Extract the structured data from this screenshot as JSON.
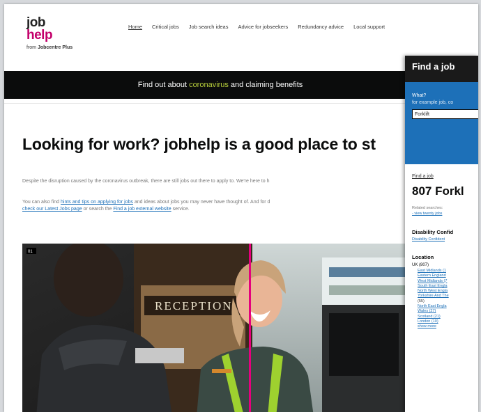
{
  "logo": {
    "line1": "job",
    "line2": "help",
    "from_prefix": "from ",
    "from_name": "Jobcentre Plus"
  },
  "nav": [
    {
      "label": "Home",
      "active": true
    },
    {
      "label": "Critical jobs"
    },
    {
      "label": "Job search ideas"
    },
    {
      "label": "Advice for jobseekers"
    },
    {
      "label": "Redundancy advice"
    },
    {
      "label": "Local support"
    }
  ],
  "banner": {
    "before": "Find out about",
    "highlight": "coronavirus",
    "after": "and claiming benefits"
  },
  "main": {
    "heading": "Looking for work? jobhelp is a good place to st",
    "para1": "Despite the disruption caused by the coronavirus outbreak, there are still jobs out there to apply to. We're here to h",
    "para2": {
      "t1": "You can also find ",
      "l1": "hints and tips on applying for jobs",
      "t2": " and ideas about jobs you may never have thought of. And for d",
      "l2": "check our Latest Jobs page",
      "t3": " or search the ",
      "l3": "Find a job external website",
      "t4": " service."
    },
    "hero_sign": "RECEPTION",
    "hero_badge": "01"
  },
  "panel": {
    "title": "Find a job",
    "what_label": "What?",
    "what_hint": "for example job, co",
    "what_value": "Forklift",
    "crumb": "Find a job",
    "count": "807 Forkl",
    "related": "Related searches: ",
    "related_line2": "- view twenty jobs",
    "section1": "Disability Confid",
    "section1_link": "Disability Confident",
    "section2": "Location",
    "uk": "UK (807)",
    "locations": [
      {
        "text": "East Midlands (1",
        "link": true
      },
      {
        "text": "Eastern England",
        "link": true
      },
      {
        "text": "West Midlands (7",
        "link": true
      },
      {
        "text": "South East Engla",
        "link": true
      },
      {
        "text": "North West Engla",
        "link": true
      },
      {
        "text": "Yorkshire And The",
        "link": true
      },
      {
        "text": "(55)",
        "link": false
      },
      {
        "text": "North East Engla",
        "link": true
      },
      {
        "text": "Wales (27)",
        "link": true
      },
      {
        "text": "Scotland (21)",
        "link": true
      },
      {
        "text": "London (10)",
        "link": true
      },
      {
        "text": "show more",
        "link": true
      }
    ]
  },
  "colors": {
    "brand_pink": "#c3006b",
    "link_blue": "#1d70b8",
    "banner_bg": "#0b0c0c",
    "banner_highlight": "#b9d03b",
    "panel_header": "#1a1a1a"
  }
}
